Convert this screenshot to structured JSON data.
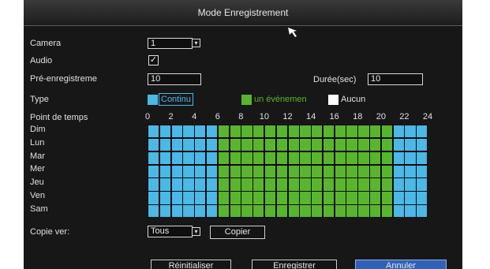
{
  "title": "Mode Enregistrement",
  "camera": {
    "label": "Camera",
    "value": "1"
  },
  "audio": {
    "label": "Audio",
    "checked": true,
    "check_glyph": "✓"
  },
  "prerecord": {
    "label": "Pré-enregistreme",
    "value": "10"
  },
  "duration": {
    "label": "Durée(sec)",
    "value": "10"
  },
  "type": {
    "label": "Type",
    "options": [
      {
        "label": "Continu",
        "color": "#4bb8e6"
      },
      {
        "label": "un événemen",
        "color": "#5ab52e"
      },
      {
        "label": "Aucun",
        "color": "#ffffff"
      }
    ]
  },
  "schedule": {
    "label": "Point de temps",
    "hour_ticks": [
      "0",
      "2",
      "4",
      "6",
      "8",
      "10",
      "12",
      "14",
      "16",
      "18",
      "20",
      "22",
      "24"
    ],
    "days": [
      "Dim",
      "Lun",
      "Mar",
      "Mer",
      "Jeu",
      "Ven",
      "Sam"
    ],
    "continu_hours": [
      [
        0,
        6
      ],
      [
        21,
        24
      ]
    ],
    "event_hours": [
      [
        6,
        21
      ]
    ]
  },
  "copy": {
    "label": "Copie ver:",
    "value": "Tous",
    "button": "Copier"
  },
  "buttons": {
    "reset": "Réinitialiser",
    "save": "Enregistrer",
    "cancel": "Annuler"
  }
}
